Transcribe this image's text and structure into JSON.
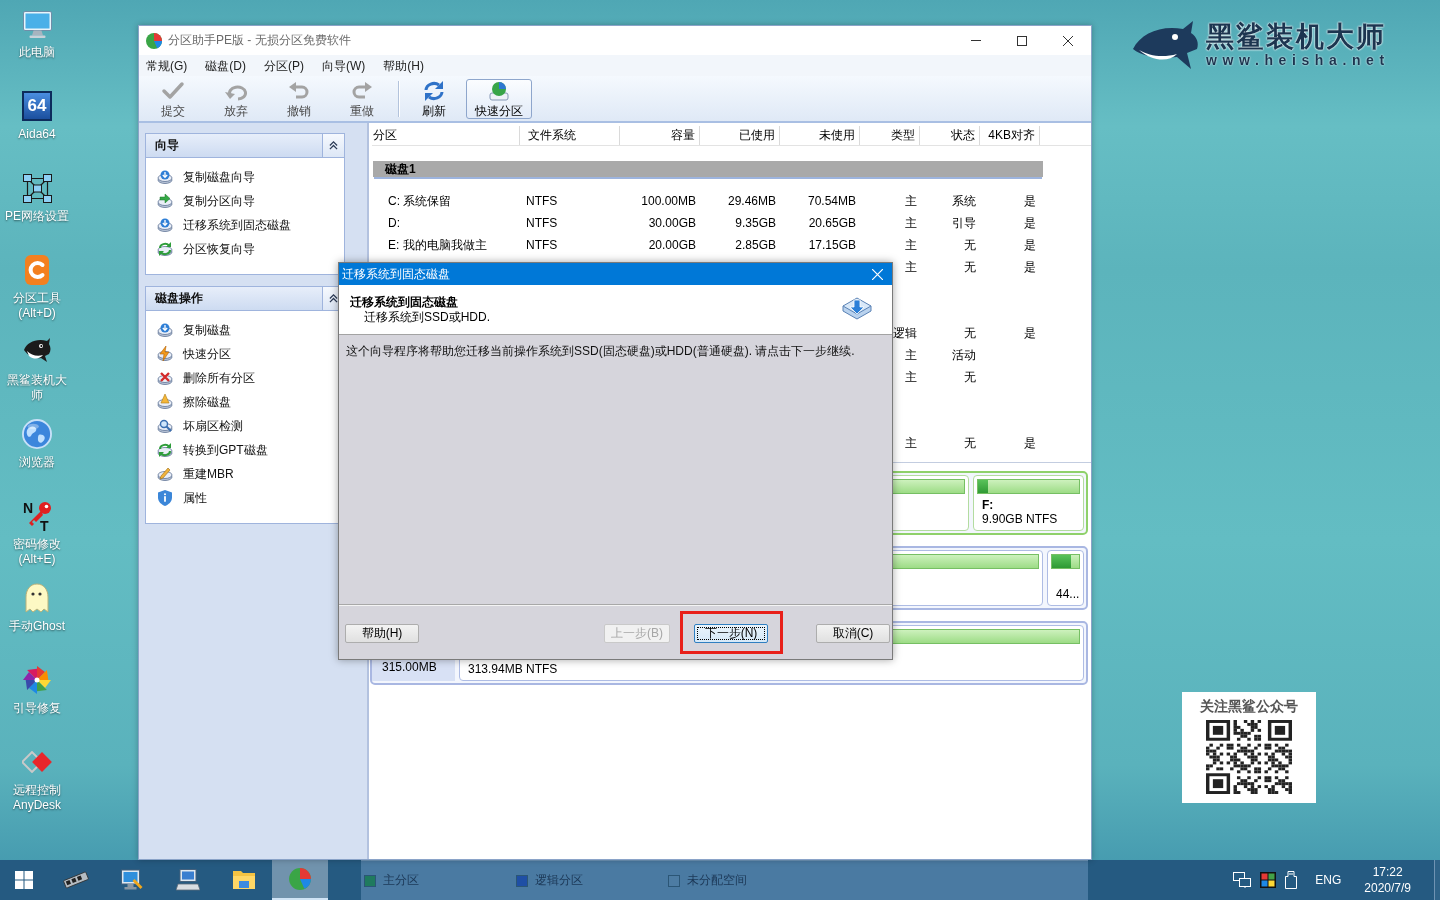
{
  "desktop_icons": [
    {
      "label": "此电脑",
      "kind": "monitor"
    },
    {
      "label": "Aida64",
      "kind": "aida",
      "icon_text": [
        "64"
      ]
    },
    {
      "label": "PE网络设置",
      "kind": "network"
    },
    {
      "label": "分区工具(Alt+D)",
      "kind": "tool"
    },
    {
      "label": "黑鲨装机大师",
      "kind": "shark"
    },
    {
      "label": "浏览器",
      "kind": "globe"
    },
    {
      "label": "密码修改(Alt+E)",
      "kind": "key",
      "icon_text": [
        "N",
        "T"
      ]
    },
    {
      "label": "手动Ghost",
      "kind": "ghost"
    },
    {
      "label": "引导修复",
      "kind": "pinwheel"
    },
    {
      "label": "远程控制AnyDesk",
      "kind": "anydesk"
    }
  ],
  "window": {
    "title": "分区助手PE版 - 无损分区免费软件",
    "menu": [
      "常规(G)",
      "磁盘(D)",
      "分区(P)",
      "向导(W)",
      "帮助(H)"
    ],
    "toolbar": [
      {
        "buttons": [
          {
            "label": "提交",
            "kind": "commit",
            "disabled": true,
            "selected": false
          },
          {
            "label": "放弃",
            "kind": "discard",
            "disabled": true,
            "selected": false
          },
          {
            "label": "撤销",
            "kind": "undo",
            "disabled": true,
            "selected": false
          },
          {
            "label": "重做",
            "kind": "redo",
            "disabled": true,
            "selected": false
          }
        ]
      },
      {
        "buttons": [
          {
            "label": "刷新",
            "kind": "refresh",
            "disabled": false,
            "selected": false
          },
          {
            "label": "快速分区",
            "kind": "quick",
            "disabled": false,
            "selected": true
          }
        ]
      }
    ],
    "sidebar": {
      "panels": [
        {
          "title": "向导",
          "expanded": true,
          "items": [
            {
              "label": "复制磁盘向导",
              "kind": "copy-disk"
            },
            {
              "label": "复制分区向导",
              "kind": "copy-partition"
            },
            {
              "label": "迁移系统到固态磁盘",
              "kind": "migrate"
            },
            {
              "label": "分区恢复向导",
              "kind": "recover"
            }
          ]
        },
        {
          "title": "磁盘操作",
          "expanded": true,
          "items": [
            {
              "label": "复制磁盘",
              "kind": "copy-disk"
            },
            {
              "label": "快速分区",
              "kind": "quick"
            },
            {
              "label": "删除所有分区",
              "kind": "delete"
            },
            {
              "label": "擦除磁盘",
              "kind": "wipe"
            },
            {
              "label": "坏扇区检测",
              "kind": "scan"
            },
            {
              "label": "转换到GPT磁盘",
              "kind": "convert"
            },
            {
              "label": "重建MBR",
              "kind": "rebuild"
            },
            {
              "label": "属性",
              "kind": "properties"
            }
          ]
        }
      ]
    },
    "table": {
      "columns": [
        "分区",
        "文件系统",
        "容量",
        "已使用",
        "未使用",
        "类型",
        "状态",
        "4KB对齐"
      ],
      "disks": [
        {
          "header": "磁盘1",
          "selected": true,
          "rows": [
            {
              "partition": "C: 系统保留",
              "file_system": "NTFS",
              "capacity": "100.00MB",
              "used": "29.46MB",
              "unused": "70.54MB",
              "type": "主",
              "status": "系统",
              "align_4k": "是"
            },
            {
              "partition": "D:",
              "file_system": "NTFS",
              "capacity": "30.00GB",
              "used": "9.35GB",
              "unused": "20.65GB",
              "type": "主",
              "status": "引导",
              "align_4k": "是"
            },
            {
              "partition": "E: 我的电脑我做主",
              "file_system": "NTFS",
              "capacity": "20.00GB",
              "used": "2.85GB",
              "unused": "17.15GB",
              "type": "主",
              "status": "无",
              "align_4k": "是"
            },
            {
              "type": "主",
              "status": "无",
              "align_4k": "是"
            }
          ]
        },
        {
          "selected": false,
          "rows": [
            {
              "type": "逻辑",
              "status": "无",
              "align_4k": "是"
            },
            {
              "type": "主",
              "status": "活动"
            },
            {
              "type": "主",
              "status": "无"
            }
          ]
        },
        {
          "selected": false,
          "rows": [
            {
              "type": "主",
              "status": "无",
              "align_4k": "是"
            }
          ]
        }
      ]
    },
    "disk_map": {
      "disks": [
        {
          "selected": true,
          "partitions": [
            {
              "kind": "primary"
            },
            {
              "kind": "primary",
              "label": "F:",
              "detail": "9.90GB NTFS",
              "level": 0.1
            }
          ]
        },
        {
          "selected": false,
          "partitions": [
            {
              "kind": "primary"
            },
            {
              "kind": "primary",
              "detail": "44...",
              "level": 0.72
            }
          ]
        },
        {
          "selected": false,
          "size": "315.00MB",
          "partitions": [
            {
              "kind": "primary",
              "detail": "313.94MB NTFS"
            }
          ]
        }
      ]
    },
    "status_bar": {
      "legend": [
        {
          "label": "主分区",
          "color": "#1f7a5e"
        },
        {
          "label": "逻辑分区",
          "color": "#1f4fa5"
        },
        {
          "label": "未分配空间",
          "color": "#4d7ca3"
        }
      ]
    }
  },
  "dialog": {
    "title": "迁移系统到固态磁盘",
    "heading": "迁移系统到固态磁盘",
    "subheading": "迁移系统到SSD或HDD.",
    "message": "这个向导程序将帮助您迁移当前操作系统到SSD(固态硬盘)或HDD(普通硬盘). 请点击下一步继续.",
    "buttons": [
      {
        "label": "帮助(H)",
        "disabled": false,
        "focused": false,
        "highlighted": false
      },
      {
        "label": "上一步(B)",
        "disabled": true,
        "focused": false,
        "highlighted": false
      },
      {
        "label": "下一步(N)",
        "disabled": false,
        "focused": true,
        "highlighted": true
      },
      {
        "label": "取消(C)",
        "disabled": false,
        "focused": false,
        "highlighted": false
      }
    ]
  },
  "brand": {
    "name": "黑鲨装机大师",
    "url": "www.heisha.net"
  },
  "qr_card": {
    "title": "关注黑鲨公众号"
  },
  "taskbar": {
    "pinned": [
      {
        "kind": "memory",
        "selected": false
      },
      {
        "kind": "computer",
        "selected": false
      },
      {
        "kind": "terminal",
        "selected": false
      },
      {
        "kind": "folder",
        "selected": false
      },
      {
        "kind": "partition-app",
        "selected": true
      }
    ],
    "tray": {
      "language": "ENG",
      "time": "17:22",
      "date": "2020/7/9"
    }
  }
}
